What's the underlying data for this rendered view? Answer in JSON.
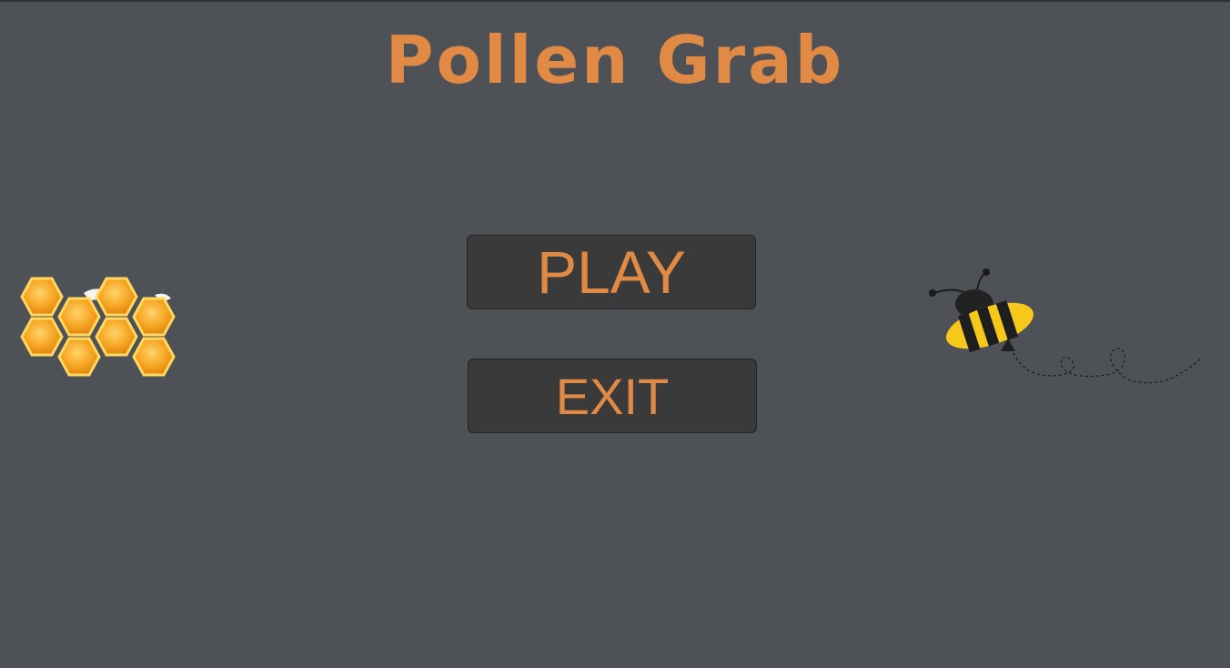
{
  "game": {
    "title": "Pollen Grab"
  },
  "menu": {
    "play_label": "PLAY",
    "exit_label": "EXIT"
  },
  "colors": {
    "background": "#4e5156",
    "accent": "#e08a45",
    "button_fill": "#3a3a3a",
    "honey": "#f5a623",
    "bee_yellow": "#f7c81c"
  },
  "icons": {
    "left_decoration": "honeycomb-icon",
    "right_decoration": "bee-icon"
  }
}
